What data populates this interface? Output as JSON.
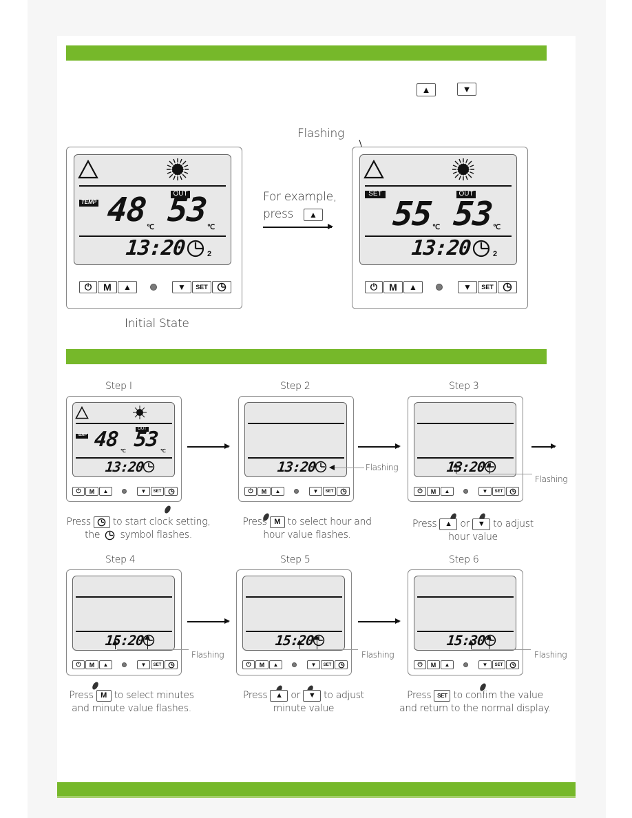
{
  "colors": {
    "accent_bar": "#76b82a",
    "lcd_bg": "#e8e8e8"
  },
  "section1": {
    "intro_buttons": [
      "up-arrow",
      "down-arrow"
    ],
    "flashing_label": "Flashing",
    "example_line1": "For example,",
    "example_line2": "press",
    "initial_state_caption": "Initial State",
    "initial": {
      "top_tag": "TEMP",
      "out_tag": "OUT",
      "left_temp": "48",
      "right_temp": "53",
      "unit": "℃",
      "time": "13:20",
      "clock_suffix": "2"
    },
    "after": {
      "top_tag": "SET",
      "out_tag": "OUT",
      "left_temp": "55",
      "right_temp": "53",
      "unit": "℃",
      "time": "13:20",
      "clock_suffix": "2"
    }
  },
  "buttons": {
    "power": "⏻",
    "mode": "M",
    "up": "▲",
    "down": "▼",
    "set": "SET",
    "clock": "clock-icon"
  },
  "steps": [
    {
      "title": "Step I",
      "time": "13:20",
      "show_temps": true,
      "temp_tag": "TEMP",
      "out_tag": "OUT",
      "left_temp": "48",
      "right_temp": "53",
      "caption_line1_pre": "Press",
      "caption_line1_post": "to start clock setting,",
      "caption_line2_pre": "the",
      "caption_line2_post": "symbol flashes."
    },
    {
      "title": "Step 2",
      "time": "13:20",
      "flashing": "Flashing",
      "caption_line1_pre": "Press",
      "caption_line1_btn": "M",
      "caption_line1_post": "to select hour and",
      "caption_line2": "hour value flashes."
    },
    {
      "title": "Step 3",
      "time": "13:20",
      "flashing": "Flashing",
      "caption_line1_pre": "Press",
      "caption_or": "or",
      "caption_line1_post": "to adjust",
      "caption_line2": "hour value"
    },
    {
      "title": "Step 4",
      "time": "15:20",
      "flashing": "Flashing",
      "caption_line1_pre": "Press",
      "caption_line1_btn": "M",
      "caption_line1_post": "to select minutes",
      "caption_line2": "and minute value flashes."
    },
    {
      "title": "Step 5",
      "time": "15:20",
      "flashing": "Flashing",
      "caption_line1_pre": "Press",
      "caption_or": "or",
      "caption_line1_post": "to adjust",
      "caption_line2": "minute value"
    },
    {
      "title": "Step 6",
      "time": "15:30",
      "flashing": "Flashing",
      "caption_line1_pre": "Press",
      "caption_line1_btn": "SET",
      "caption_line1_post": "to confim the value",
      "caption_line2": "and return to the normal display."
    }
  ]
}
